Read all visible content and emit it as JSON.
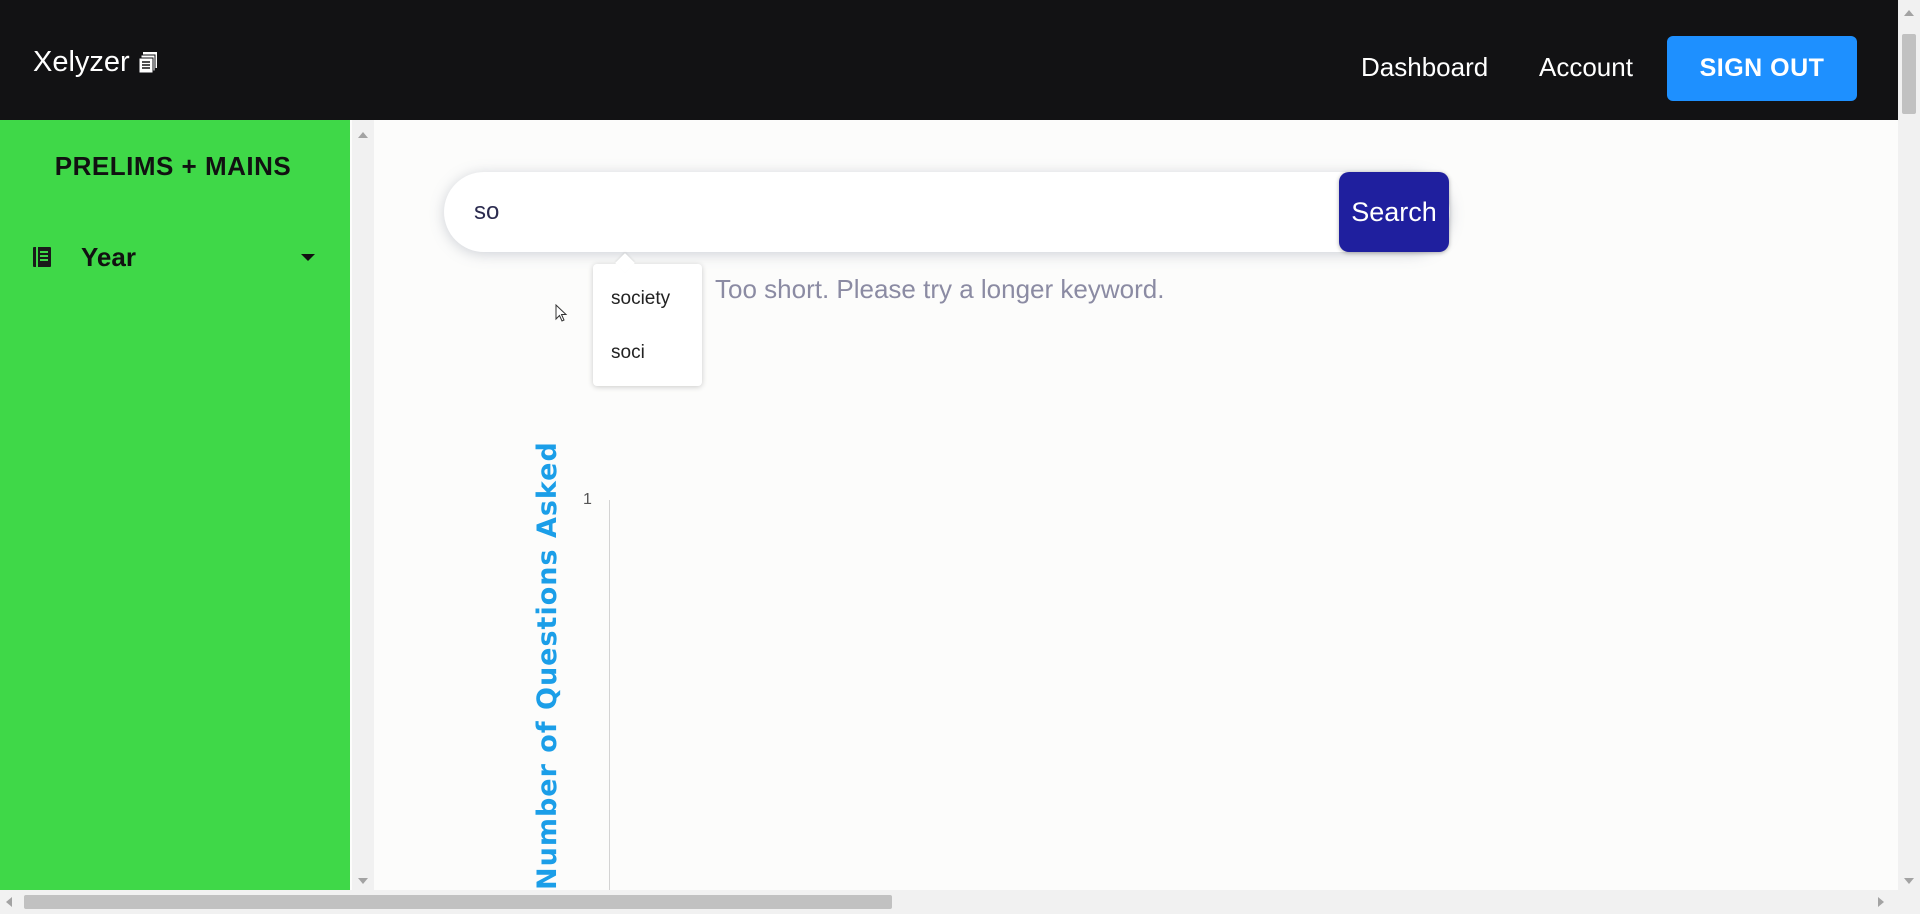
{
  "header": {
    "brand": "Xelyzer",
    "brand_icon": "document-stack-icon",
    "nav": {
      "dashboard": "Dashboard",
      "account": "Account"
    },
    "signout_label": "SIGN OUT",
    "colors": {
      "bar": "#121214",
      "signout": "#1e90ff"
    }
  },
  "sidebar": {
    "title": "PRELIMS + MAINS",
    "items": [
      {
        "label": "Year",
        "icon": "book-icon",
        "expand_icon": "caret-down-icon"
      }
    ],
    "color": "#3fd848"
  },
  "search": {
    "value": "so",
    "button_label": "Search",
    "button_color": "#1f1f9e"
  },
  "suggestions": [
    "society",
    "soci"
  ],
  "hint": "Too short. Please try a longer keyword.",
  "chart_data": {
    "type": "bar",
    "title": "",
    "ylabel": "Number of Questions Asked",
    "xlabel": "",
    "y_ticks": [
      "1"
    ],
    "categories": [],
    "values": []
  }
}
